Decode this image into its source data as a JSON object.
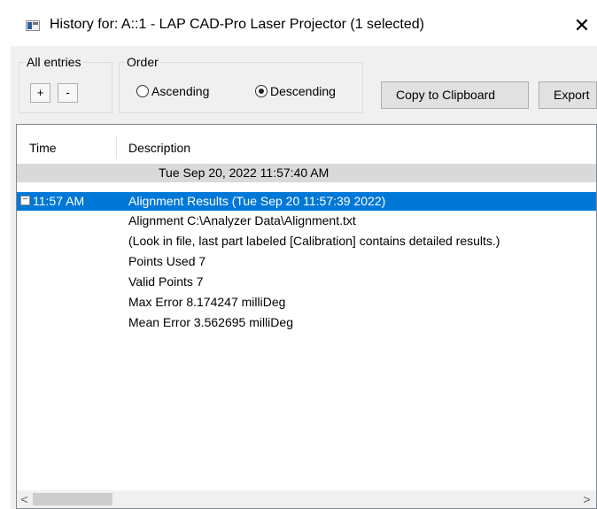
{
  "window": {
    "title": "History for: A::1 - LAP CAD-Pro Laser Projector (1 selected)",
    "close_glyph": "✕"
  },
  "all_entries": {
    "legend": "All entries",
    "expand_label": "+",
    "collapse_label": "-"
  },
  "order": {
    "legend": "Order",
    "options": [
      {
        "label": "Ascending",
        "checked": false
      },
      {
        "label": "Descending",
        "checked": true
      }
    ]
  },
  "toolbar": {
    "copy_label": "Copy to Clipboard",
    "export_label": "Export"
  },
  "list": {
    "columns": [
      "Time",
      "Description"
    ],
    "date_row": "Tue Sep 20, 2022  11:57:40 AM",
    "selected_row": {
      "expander": "−",
      "time": "11:57 AM",
      "description": "Alignment Results (Tue Sep 20 11:57:39 2022)"
    },
    "details": [
      "Alignment C:\\Analyzer Data\\Alignment.txt",
      "(Look in file, last part labeled [Calibration] contains detailed results.)",
      "Points Used 7",
      "Valid Points 7",
      "Max Error 8.174247 milliDeg",
      "Mean Error 3.562695 milliDeg"
    ]
  },
  "scrollbar": {
    "left_arrow": "<",
    "right_arrow": ">"
  },
  "colors": {
    "selection": "#0078d7",
    "date_row": "#d9d9d9",
    "dialog_bg": "#f0f0f0"
  }
}
